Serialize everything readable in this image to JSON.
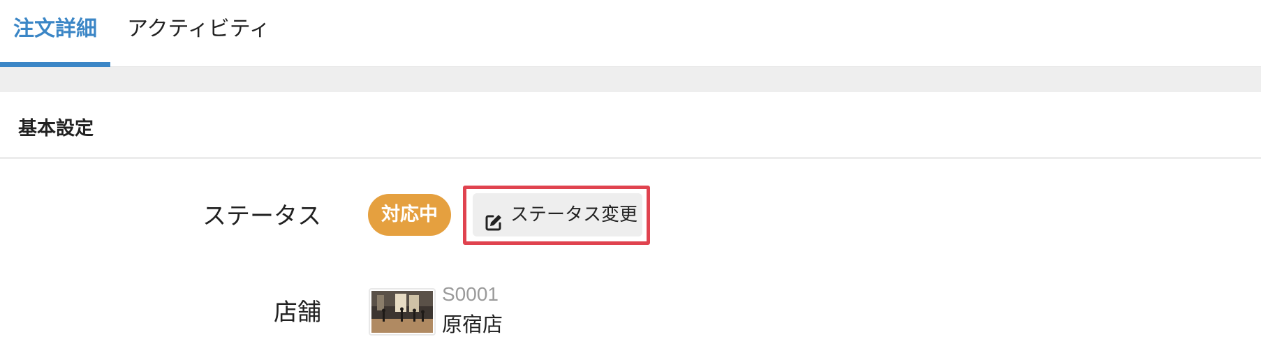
{
  "tabs": [
    {
      "label": "注文詳細",
      "active": true
    },
    {
      "label": "アクティビティ",
      "active": false
    }
  ],
  "section": {
    "title": "基本設定"
  },
  "fields": {
    "status": {
      "label": "ステータス",
      "badge": "対応中",
      "badge_color": "#e5a03f",
      "change_button": "ステータス変更",
      "change_icon": "edit-icon"
    },
    "store": {
      "label": "店舗",
      "code": "S0001",
      "name": "原宿店",
      "thumbnail": "store-photo"
    }
  },
  "colors": {
    "accent": "#3b86c6",
    "highlight": "#e0434f"
  }
}
